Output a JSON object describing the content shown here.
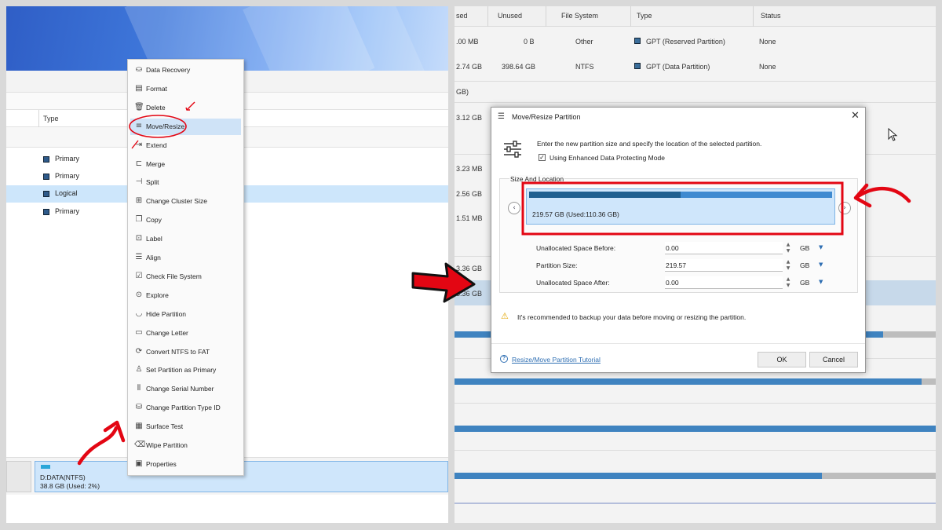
{
  "left": {
    "column_header": "Type",
    "partitions": [
      {
        "type": "Primary",
        "selected": false
      },
      {
        "type": "Primary",
        "selected": false
      },
      {
        "type": "Logical",
        "selected": true
      },
      {
        "type": "Primary",
        "selected": false
      }
    ],
    "disk_map": {
      "name": "D:DATA(NTFS)",
      "detail": "38.8 GB (Used: 2%)"
    },
    "context_menu": [
      {
        "label": "Data Recovery",
        "icon": "data-recovery-icon",
        "glyph": "⛀"
      },
      {
        "label": "Format",
        "icon": "format-icon",
        "glyph": "▤"
      },
      {
        "label": "Delete",
        "icon": "delete-icon",
        "glyph": "🗑"
      },
      {
        "label": "Move/Resize",
        "icon": "move-resize-icon",
        "glyph": "≡",
        "highlighted": true
      },
      {
        "label": "Extend",
        "icon": "extend-icon",
        "glyph": "⇥"
      },
      {
        "label": "Merge",
        "icon": "merge-icon",
        "glyph": "⊏"
      },
      {
        "label": "Split",
        "icon": "split-icon",
        "glyph": "⊣"
      },
      {
        "label": "Change Cluster Size",
        "icon": "cluster-icon",
        "glyph": "⊞"
      },
      {
        "label": "Copy",
        "icon": "copy-icon",
        "glyph": "❐"
      },
      {
        "label": "Label",
        "icon": "label-icon",
        "glyph": "⊡"
      },
      {
        "label": "Align",
        "icon": "align-icon",
        "glyph": "☰"
      },
      {
        "label": "Check File System",
        "icon": "check-file-system-icon",
        "glyph": "☑"
      },
      {
        "label": "Explore",
        "icon": "explore-icon",
        "glyph": "⊙"
      },
      {
        "label": "Hide Partition",
        "icon": "hide-icon",
        "glyph": "◡"
      },
      {
        "label": "Change Letter",
        "icon": "change-letter-icon",
        "glyph": "▭"
      },
      {
        "label": "Convert NTFS to FAT",
        "icon": "convert-icon",
        "glyph": "⟳"
      },
      {
        "label": "Set Partition as Primary",
        "icon": "set-primary-icon",
        "glyph": "♙"
      },
      {
        "label": "Change Serial Number",
        "icon": "serial-icon",
        "glyph": "⦀"
      },
      {
        "label": "Change Partition Type ID",
        "icon": "type-id-icon",
        "glyph": "⛁"
      },
      {
        "label": "Surface Test",
        "icon": "surface-test-icon",
        "glyph": "▦"
      },
      {
        "label": "Wipe Partition",
        "icon": "wipe-icon",
        "glyph": "⌫"
      },
      {
        "label": "Properties",
        "icon": "properties-icon",
        "glyph": "▣"
      }
    ]
  },
  "right": {
    "columns": [
      "sed",
      "Unused",
      "File System",
      "Type",
      "Status"
    ],
    "rows": [
      {
        "used": ".00 MB",
        "unused": "0 B",
        "fs": "Other",
        "type": "GPT (Reserved Partition)",
        "status": "None"
      },
      {
        "used": "2.74 GB",
        "unused": "398.64 GB",
        "fs": "NTFS",
        "type": "GPT (Data Partition)",
        "status": "None"
      }
    ],
    "fragments": [
      "GB)",
      "3.12 GB",
      "3.23 MB",
      "2.56 GB",
      "1.51 MB",
      "3.36 GB",
      "3.36 GB"
    ]
  },
  "dialog": {
    "title": "Move/Resize Partition",
    "instruction": "Enter the new partition size and specify the location of the selected partition.",
    "checkbox_label": "Using Enhanced Data Protecting Mode",
    "checkbox_checked": true,
    "group_label": "Size And Location",
    "slider_text": "219.57 GB (Used:110.36 GB)",
    "used_fraction": 0.5,
    "fields": [
      {
        "label": "Unallocated Space Before:",
        "value": "0.00",
        "unit": "GB"
      },
      {
        "label": "Partition Size:",
        "value": "219.57",
        "unit": "GB"
      },
      {
        "label": "Unallocated Space After:",
        "value": "0.00",
        "unit": "GB"
      }
    ],
    "warning": "It's recommended to backup your data before moving or resizing the partition.",
    "tutorial_link": "Resize/Move Partition Tutorial",
    "ok": "OK",
    "cancel": "Cancel"
  },
  "colors": {
    "accent": "#2f6fb3",
    "annotation_red": "#e30613",
    "selection": "#cde6fb"
  }
}
